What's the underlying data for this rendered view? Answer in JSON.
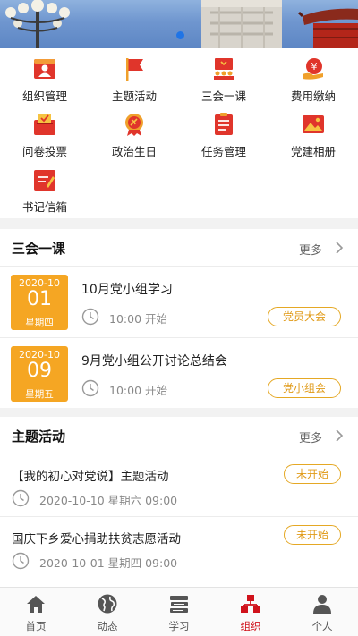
{
  "banner": {
    "slide_count": 1,
    "active_slide": 1
  },
  "grid": [
    {
      "label": "组织管理",
      "icon": "org-manage-icon"
    },
    {
      "label": "主题活动",
      "icon": "flag-icon"
    },
    {
      "label": "三会一课",
      "icon": "meeting-icon"
    },
    {
      "label": "费用缴纳",
      "icon": "fee-payment-icon"
    },
    {
      "label": "问卷投票",
      "icon": "vote-box-icon"
    },
    {
      "label": "政治生日",
      "icon": "party-badge-icon"
    },
    {
      "label": "任务管理",
      "icon": "task-list-icon"
    },
    {
      "label": "党建相册",
      "icon": "photo-album-icon"
    },
    {
      "label": "书记信箱",
      "icon": "mailbox-icon"
    }
  ],
  "meetings": {
    "title": "三会一课",
    "more": "更多",
    "items": [
      {
        "ym": "2020-10",
        "day": "01",
        "weekday": "星期四",
        "title": "10月党小组学习",
        "time": "10:00 开始",
        "tag": "党员大会"
      },
      {
        "ym": "2020-10",
        "day": "09",
        "weekday": "星期五",
        "title": "9月党小组公开讨论总结会",
        "time": "10:00 开始",
        "tag": "党小组会"
      }
    ]
  },
  "activities": {
    "title": "主题活动",
    "more": "更多",
    "items": [
      {
        "title": "【我的初心对党说】主题活动",
        "time": "2020-10-10 星期六 09:00",
        "status": "未开始"
      },
      {
        "title": "国庆下乡爱心捐助扶贫志愿活动",
        "time": "2020-10-01 星期四 09:00",
        "status": "未开始"
      }
    ]
  },
  "tabbar": [
    {
      "label": "首页",
      "icon": "home-icon",
      "active": false
    },
    {
      "label": "动态",
      "icon": "globe-icon",
      "active": false
    },
    {
      "label": "学习",
      "icon": "book-stack-icon",
      "active": false
    },
    {
      "label": "组织",
      "icon": "organization-icon",
      "active": true
    },
    {
      "label": "个人",
      "icon": "person-icon",
      "active": false
    }
  ],
  "colors": {
    "primary_red": "#d0121b",
    "accent_orange": "#f5a623",
    "tag_border": "#e5a824"
  }
}
